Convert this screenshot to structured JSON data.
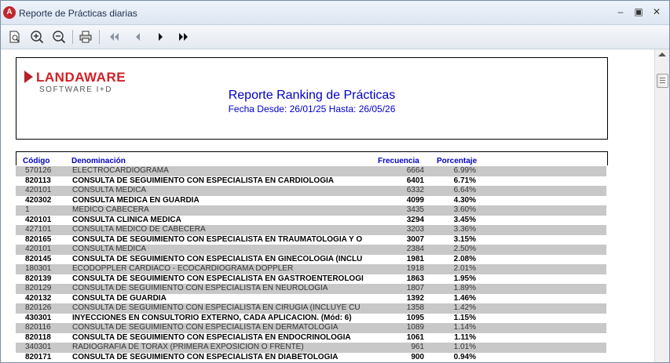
{
  "window": {
    "title": "Reporte de Prácticas diarias"
  },
  "toolbar": {
    "buttons": [
      "page-setup-icon",
      "zoom-in-icon",
      "zoom-out-icon",
      "print-icon",
      "first-page-icon",
      "previous-page-icon",
      "next-page-icon",
      "last-page-icon"
    ]
  },
  "report": {
    "logo": {
      "name": "LANDAWARE",
      "tagline": "SOFTWARE I+D"
    },
    "title": "Reporte Ranking de Prácticas",
    "subtitle": "Fecha Desde: 26/01/25 Hasta: 26/05/26",
    "columns": {
      "code": "Código",
      "name": "Denominación",
      "freq": "Frecuencia",
      "pct": "Porcentaje"
    },
    "rows": [
      {
        "code": "570126",
        "name": "ELECTROCARDIOGRAMA",
        "freq": "6664",
        "pct": "6.99%"
      },
      {
        "code": "820113",
        "name": "CONSULTA DE SEGUIMIENTO CON ESPECIALISTA EN CARDIOLOGIA",
        "freq": "6401",
        "pct": "6.71%"
      },
      {
        "code": "420101",
        "name": "CONSULTA MEDICA",
        "freq": "6332",
        "pct": "6.64%"
      },
      {
        "code": "420302",
        "name": "CONSULTA MEDICA EN GUARDIA",
        "freq": "4099",
        "pct": "4.30%"
      },
      {
        "code": "1",
        "name": "MEDICO CABECERA",
        "freq": "3435",
        "pct": "3.60%"
      },
      {
        "code": "420101",
        "name": "CONSULTA CLINICA MEDICA",
        "freq": "3294",
        "pct": "3.45%"
      },
      {
        "code": "427101",
        "name": "CONSULTA MEDICO DE CABECERA",
        "freq": "3203",
        "pct": "3.36%"
      },
      {
        "code": "820165",
        "name": "CONSULTA DE SEGUIMIENTO CON ESPECIALISTA EN TRAUMATOLOGIA Y O",
        "freq": "3007",
        "pct": "3.15%"
      },
      {
        "code": "420101",
        "name": "CONSULTA MEDICA",
        "freq": "2384",
        "pct": "2.50%"
      },
      {
        "code": "820145",
        "name": "CONSULTA DE SEGUIMIENTO CON ESPECIALISTA EN GINECOLOGIA (INCLU",
        "freq": "1981",
        "pct": "2.08%"
      },
      {
        "code": "180301",
        "name": "ECODOPPLER CARDIACO - ECOCARDIOGRAMA DOPPLER",
        "freq": "1918",
        "pct": "2.01%"
      },
      {
        "code": "820139",
        "name": "CONSULTA DE SEGUIMIENTO CON ESPECIALISTA EN GASTROENTEROLOGI",
        "freq": "1863",
        "pct": "1.95%"
      },
      {
        "code": "820129",
        "name": "CONSULTA DE SEGUIMIENTO CON ESPECIALISTA EN NEUROLOGIA",
        "freq": "1807",
        "pct": "1.89%"
      },
      {
        "code": "420132",
        "name": "CONSULTA DE GUARDIA",
        "freq": "1392",
        "pct": "1.46%"
      },
      {
        "code": "820126",
        "name": "CONSULTA DE SEGUIMIENTO CON ESPECIALISTA EN CIRUGIA (INCLUYE CU",
        "freq": "1358",
        "pct": "1.42%"
      },
      {
        "code": "430301",
        "name": "INYECCIONES EN CONSULTORIO EXTERNO, CADA APLICACION. (Mód: 6)",
        "freq": "1095",
        "pct": "1.15%"
      },
      {
        "code": "820116",
        "name": "CONSULTA DE SEGUIMIENTO CON ESPECIALISTA EN DERMATOLOGIA",
        "freq": "1089",
        "pct": "1.14%"
      },
      {
        "code": "820118",
        "name": "CONSULTA DE SEGUIMIENTO CON ESPECIALISTA EN ENDOCRINOLOGIA",
        "freq": "1061",
        "pct": "1.11%"
      },
      {
        "code": "340301",
        "name": "RADIOGRAFIA DE TORAX (PRIMERA EXPOSICION O FRENTE)",
        "freq": "961",
        "pct": "1.01%"
      },
      {
        "code": "820171",
        "name": "CONSULTA DE SEGUIMIENTO CON ESPECIALISTA EN DIABETOLOGIA",
        "freq": "900",
        "pct": "0.94%"
      }
    ]
  }
}
